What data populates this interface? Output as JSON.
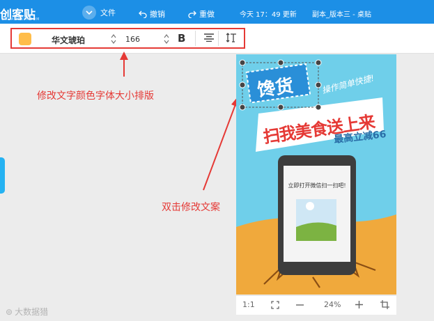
{
  "app": {
    "logo": "创客贴",
    "logo_sub": "CHUANGKIT.COM",
    "menu_file": "文件",
    "undo": "撤销",
    "redo": "重做",
    "save_status": "今天 17：49 更新",
    "doc_title": "副本_版本三 - 桌贴"
  },
  "toolbar": {
    "color": "#ffbd4a",
    "font_family": "华文琥珀",
    "font_size": "166",
    "bold_label": "B"
  },
  "annotations": {
    "toolbar_note": "修改文字颜色字体大小排版",
    "canvas_note": "双击修改文案"
  },
  "poster": {
    "headline_badge": "馋货",
    "tagline": "操作简单快捷!",
    "main_slogan": "扫我美食送上来",
    "discount": "最高立减66",
    "phone_text": "立即打开微信扫一扫吧!"
  },
  "bottombar": {
    "ratio": "1:1",
    "zoom": "24%"
  },
  "watermark": "大数据猎"
}
